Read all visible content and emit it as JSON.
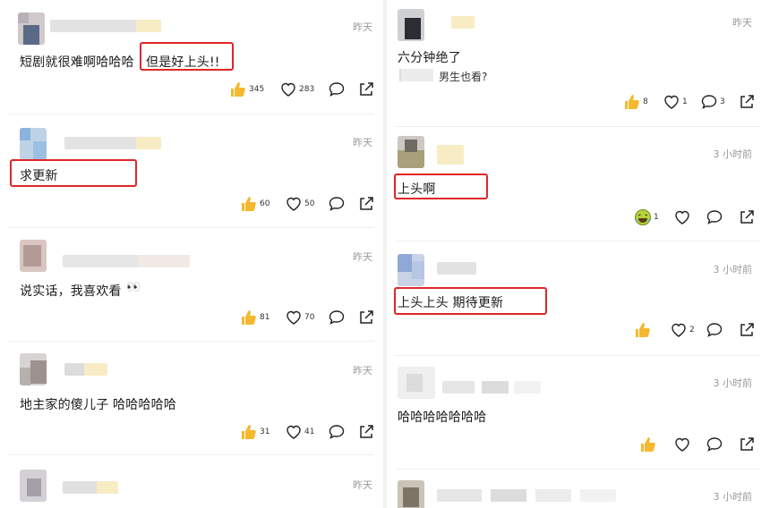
{
  "left": {
    "comments": [
      {
        "time": "昨天",
        "text": "短剧就很难啊哈哈哈",
        "highlight": "但是好上头!!",
        "likes": "345",
        "hearts": "283",
        "like_icon": "thumbs-up-icon"
      },
      {
        "time": "昨天",
        "text": "",
        "highlight": "求更新",
        "likes": "60",
        "hearts": "50",
        "like_icon": "thumbs-up-icon"
      },
      {
        "time": "昨天",
        "text": "说实话，我喜欢看",
        "emoji": "👀",
        "likes": "81",
        "hearts": "70",
        "like_icon": "thumbs-up-icon"
      },
      {
        "time": "昨天",
        "text": "地主家的傻儿子 哈哈哈哈哈",
        "likes": "31",
        "hearts": "41",
        "like_icon": "thumbs-up-icon"
      },
      {
        "time": "昨天"
      }
    ]
  },
  "right": {
    "comments": [
      {
        "time": "昨天",
        "text": "六分钟绝了",
        "reply": "男生也看?",
        "likes": "8",
        "hearts": "1",
        "replies": "3",
        "like_icon": "thumbs-up-icon"
      },
      {
        "time": "3 小时前",
        "highlight": "上头啊",
        "likes": "1",
        "like_icon": "laughing-emoji-icon"
      },
      {
        "time": "3 小时前",
        "highlight": "上头上头 期待更新",
        "hearts": "2",
        "like_icon": "thumbs-up-icon"
      },
      {
        "time": "3 小时前",
        "text": "哈哈哈哈哈哈哈",
        "like_icon": "thumbs-up-icon"
      },
      {
        "time": "3 小时前"
      }
    ]
  },
  "colors": {
    "highlight_border": "#e0262a",
    "thumb": "#f5b82e",
    "text": "#1a1a1a",
    "muted": "#9a9a9a"
  }
}
